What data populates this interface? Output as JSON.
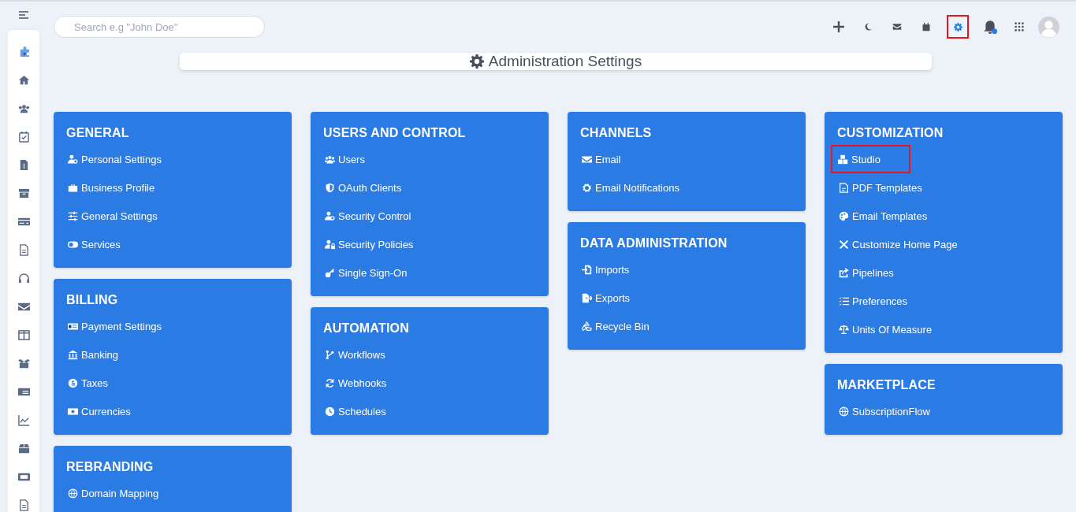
{
  "search": {
    "placeholder": "Search e.g \"John Doe\""
  },
  "toolbar": [
    {
      "kind": "plus",
      "highlighted": false
    },
    {
      "kind": "moon",
      "highlighted": false
    },
    {
      "kind": "mail",
      "highlighted": false
    },
    {
      "kind": "calendar",
      "highlighted": false
    },
    {
      "kind": "settings",
      "highlighted": true
    },
    {
      "kind": "bell",
      "highlighted": false
    },
    {
      "kind": "apps",
      "highlighted": false
    },
    {
      "kind": "avatar",
      "highlighted": false
    }
  ],
  "page_title": "Administration Settings",
  "columns": [
    [
      {
        "title": "GENERAL",
        "items": [
          {
            "label": "Personal Settings",
            "highlighted": false
          },
          {
            "label": "Business Profile",
            "highlighted": false
          },
          {
            "label": "General Settings",
            "highlighted": false
          },
          {
            "label": "Services",
            "highlighted": false
          }
        ]
      },
      {
        "title": "BILLING",
        "items": [
          {
            "label": "Payment Settings",
            "highlighted": false
          },
          {
            "label": "Banking",
            "highlighted": false
          },
          {
            "label": "Taxes",
            "highlighted": false
          },
          {
            "label": "Currencies",
            "highlighted": false
          }
        ]
      },
      {
        "title": "REBRANDING",
        "items": [
          {
            "label": "Domain Mapping",
            "highlighted": false
          }
        ]
      }
    ],
    [
      {
        "title": "USERS AND CONTROL",
        "items": [
          {
            "label": "Users",
            "highlighted": false
          },
          {
            "label": "OAuth Clients",
            "highlighted": false
          },
          {
            "label": "Security Control",
            "highlighted": false
          },
          {
            "label": "Security Policies",
            "highlighted": false
          },
          {
            "label": "Single Sign-On",
            "highlighted": false
          }
        ]
      },
      {
        "title": "AUTOMATION",
        "items": [
          {
            "label": "Workflows",
            "highlighted": false
          },
          {
            "label": "Webhooks",
            "highlighted": false
          },
          {
            "label": "Schedules",
            "highlighted": false
          }
        ]
      }
    ],
    [
      {
        "title": "CHANNELS",
        "items": [
          {
            "label": "Email",
            "highlighted": false
          },
          {
            "label": "Email Notifications",
            "highlighted": false
          }
        ]
      },
      {
        "title": "DATA ADMINISTRATION",
        "items": [
          {
            "label": "Imports",
            "highlighted": false
          },
          {
            "label": "Exports",
            "highlighted": false
          },
          {
            "label": "Recycle Bin",
            "highlighted": false
          }
        ]
      }
    ],
    [
      {
        "title": "CUSTOMIZATION",
        "items": [
          {
            "label": "Studio",
            "highlighted": true
          },
          {
            "label": "PDF Templates",
            "highlighted": false
          },
          {
            "label": "Email Templates",
            "highlighted": false
          },
          {
            "label": "Customize Home Page",
            "highlighted": false
          },
          {
            "label": "Pipelines",
            "highlighted": false
          },
          {
            "label": "Preferences",
            "highlighted": false
          },
          {
            "label": "Units Of Measure",
            "highlighted": false
          }
        ]
      },
      {
        "title": "MARKETPLACE",
        "items": [
          {
            "label": "SubscriptionFlow",
            "highlighted": false
          }
        ]
      }
    ]
  ]
}
